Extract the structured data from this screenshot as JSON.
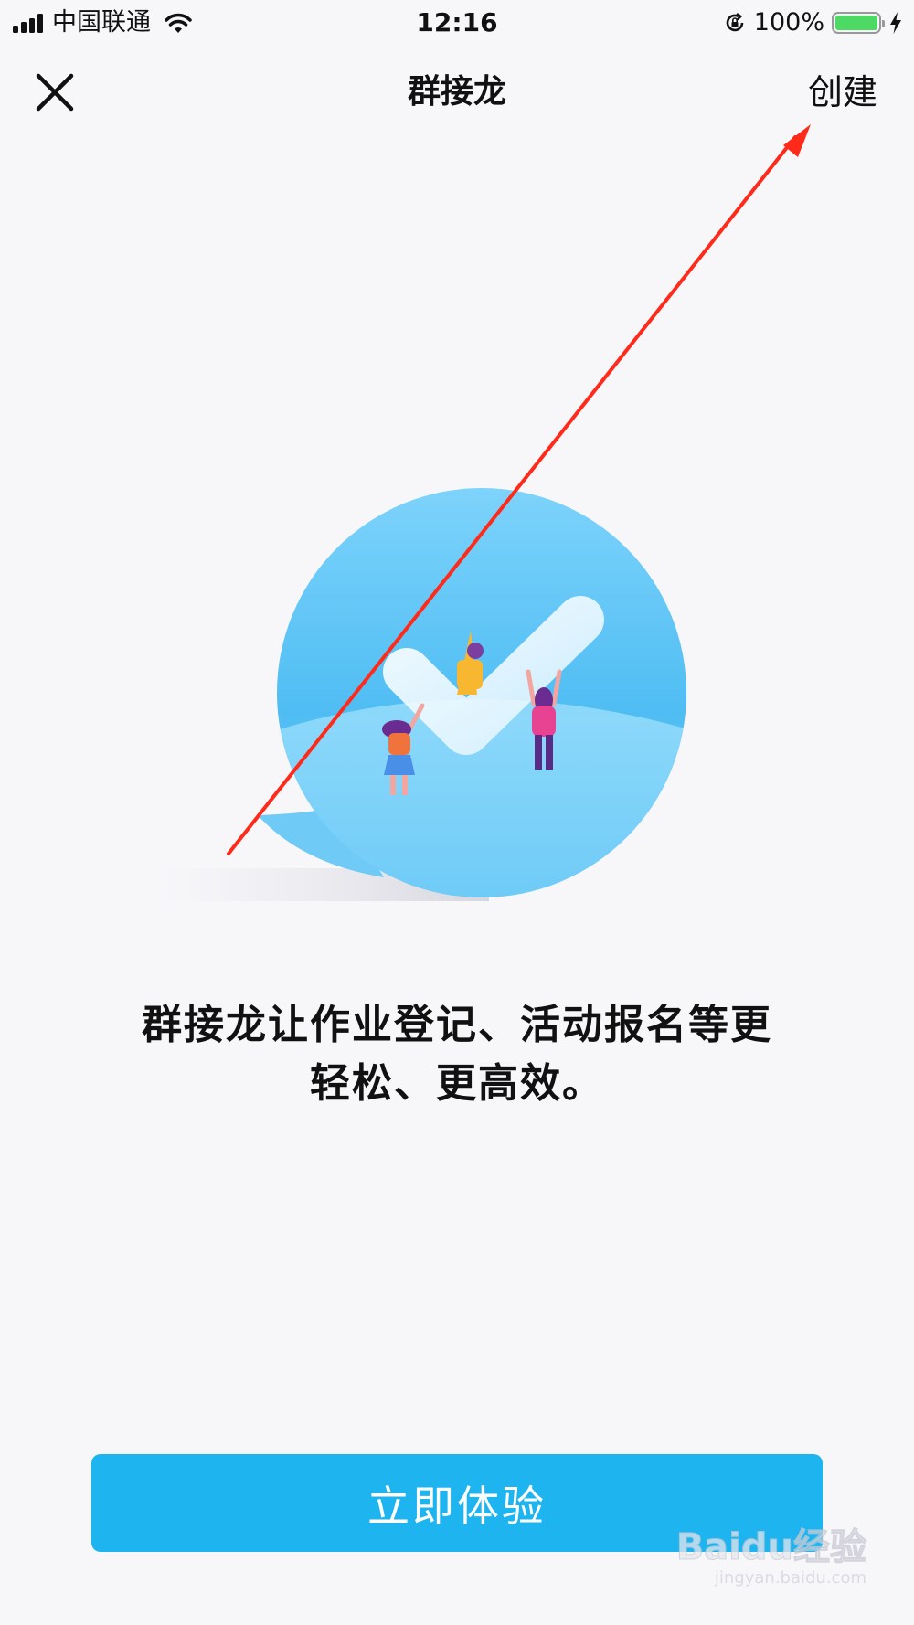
{
  "status_bar": {
    "carrier": "中国联通",
    "time": "12:16",
    "battery_percent": "100%",
    "battery_level": 1.0,
    "icons": [
      "signal-icon",
      "wifi-icon",
      "orientation-lock-icon",
      "battery-icon",
      "charging-bolt-icon"
    ]
  },
  "nav": {
    "title": "群接龙",
    "close_icon": "close-icon",
    "create_label": "创建"
  },
  "main": {
    "headline_line1": "群接龙让作业登记、活动报名等更",
    "headline_line2": "轻松、更高效。",
    "cta_label": "立即体验"
  },
  "watermark": {
    "brand": "Baidu经验",
    "url": "jingyan.baidu.com"
  },
  "colors": {
    "background": "#f7f7fa",
    "cta": "#1db4ef",
    "bubble": "#5cc4f5",
    "annotation_arrow": "#ff2a1a"
  }
}
